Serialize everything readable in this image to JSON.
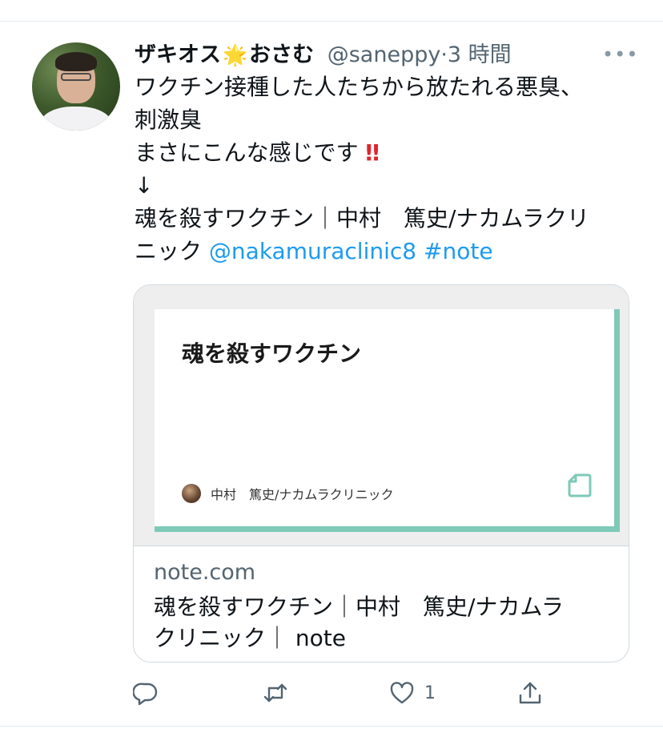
{
  "tweet": {
    "author_name": "ザキオス",
    "author_badge": "🌟",
    "author_name_suffix": "おさむ",
    "handle": "@saneppy",
    "time_separator": "·",
    "time": "3 時間",
    "more_label": "•••",
    "text_lines": [
      "ワクチン接種した人たちから放たれる悪臭、",
      "刺激臭",
      "まさにこんな感じです",
      "↓",
      "魂を殺すワクチン｜中村　篤史/ナカムラクリ",
      "ニック"
    ],
    "exclamation": "‼",
    "mention": "@nakamuraclinic8",
    "hashtag": "#note"
  },
  "card": {
    "preview_title": "魂を殺すワクチン",
    "preview_author": "中村　篤史/ナカムラクリニック",
    "domain": "note.com",
    "title_lines": [
      "魂を殺すワクチン｜中村　篤史/ナカムラ",
      "クリニック｜ note"
    ],
    "accent_color": "#7ec9b8"
  },
  "actions": {
    "reply_icon": "reply-icon",
    "retweet_icon": "retweet-icon",
    "like_icon": "like-icon",
    "like_count": "1",
    "share_icon": "share-icon"
  },
  "colors": {
    "link": "#1d9bf0",
    "secondary_text": "#536471",
    "border": "#cfd9de"
  }
}
